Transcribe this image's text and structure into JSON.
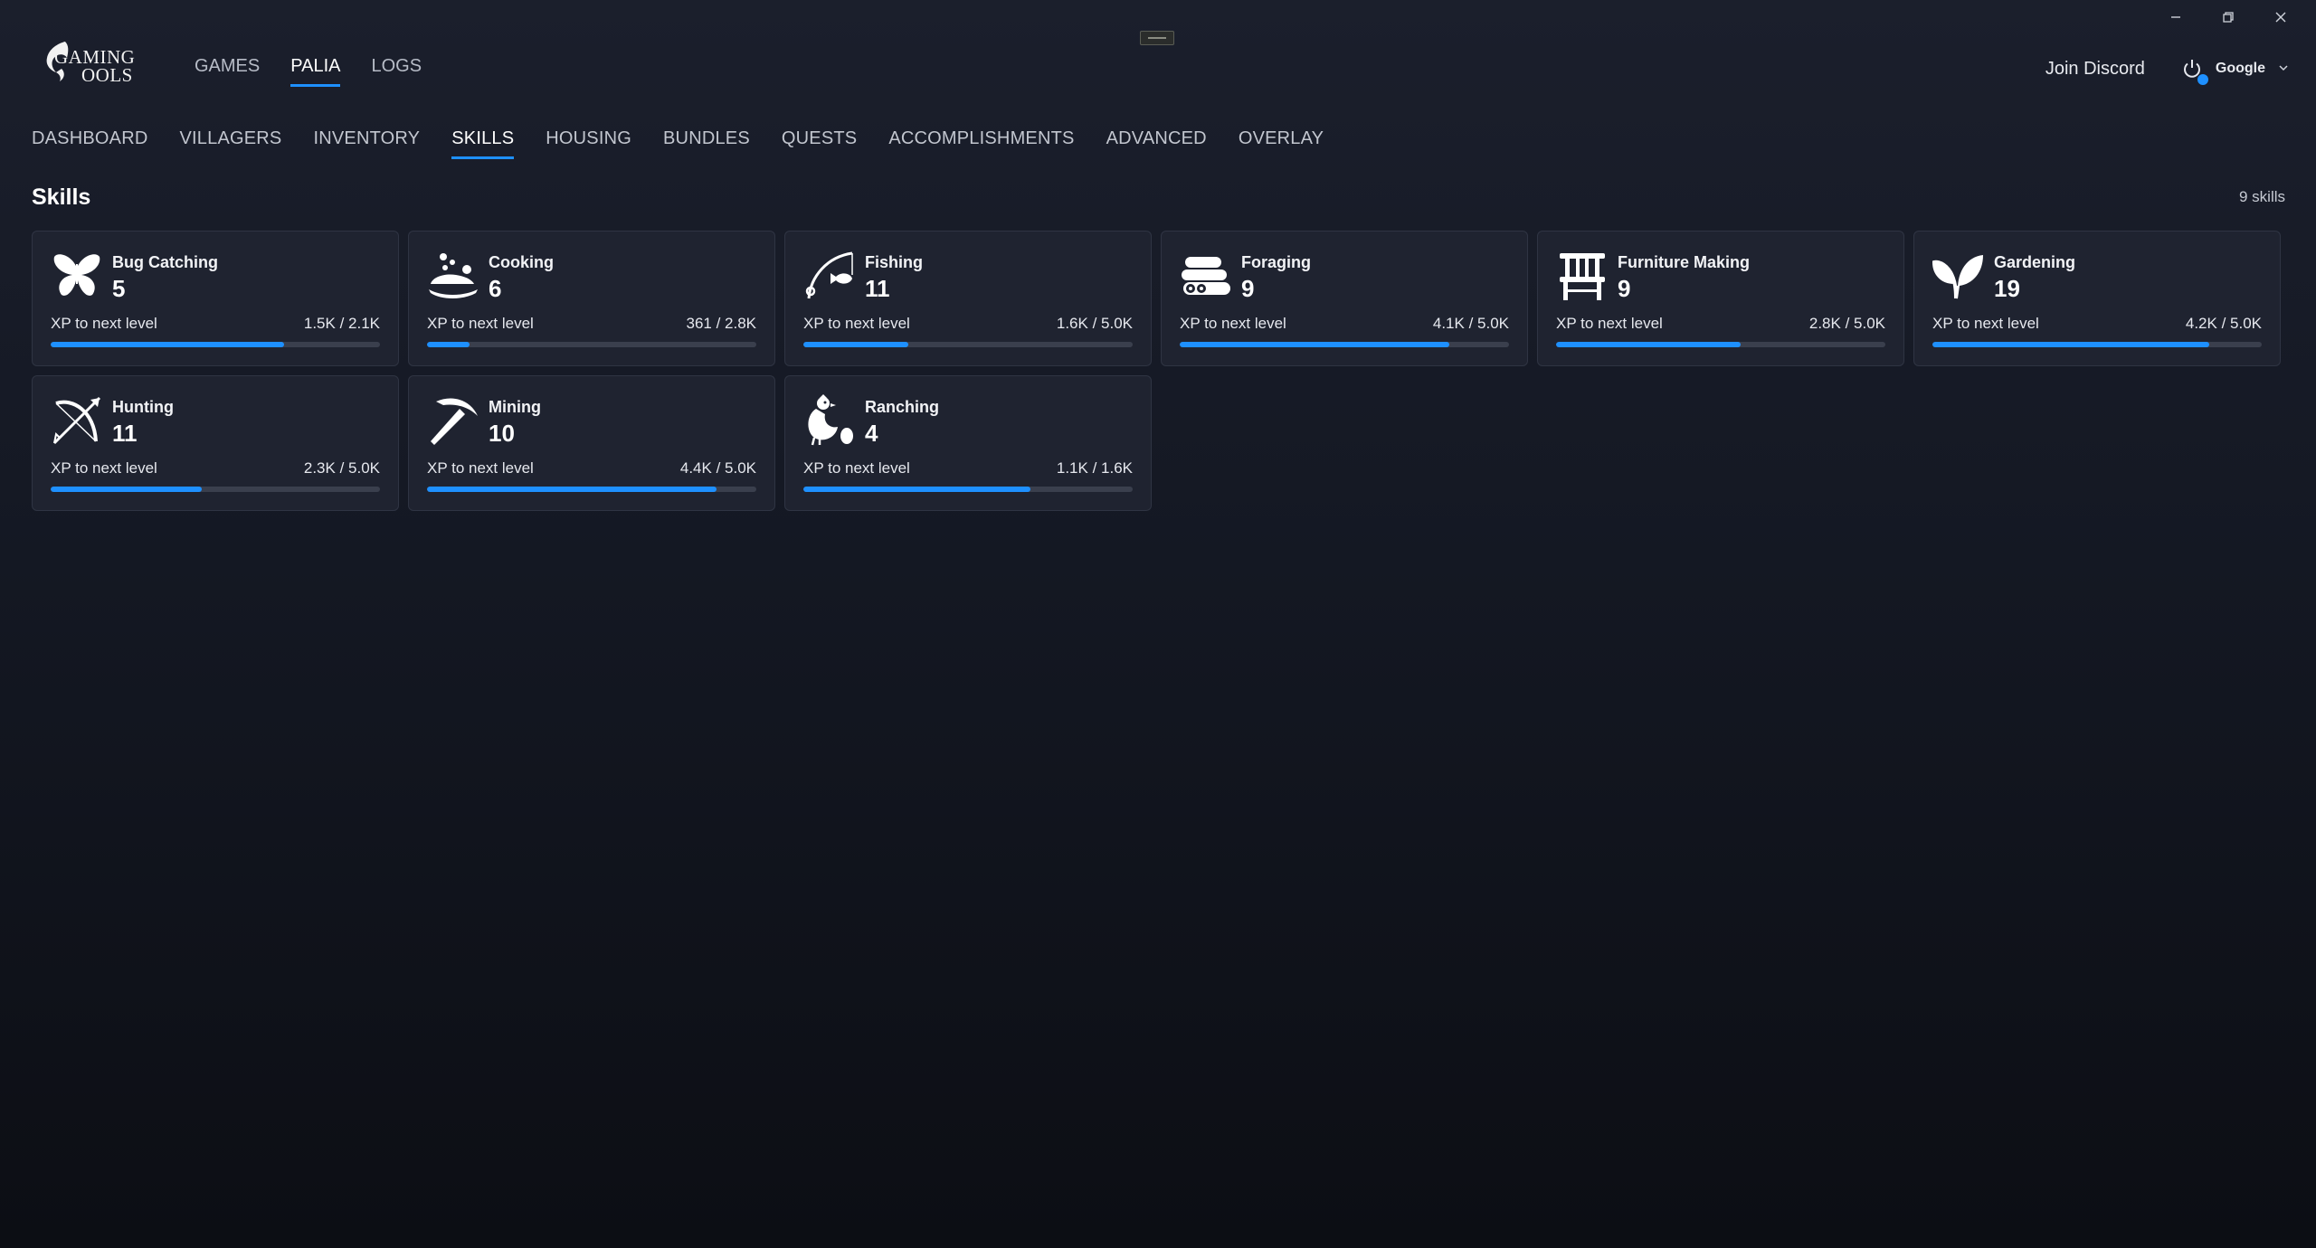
{
  "logo": {
    "line1": "GAMING",
    "line2": "OOLS",
    "icon": "dragon-logo-icon"
  },
  "top_nav": [
    {
      "label": "GAMES",
      "active": false
    },
    {
      "label": "PALIA",
      "active": true
    },
    {
      "label": "LOGS",
      "active": false
    }
  ],
  "header": {
    "discord": "Join Discord",
    "user_name": "Google",
    "status_color": "#1e90ff"
  },
  "sub_nav": [
    {
      "label": "DASHBOARD",
      "active": false
    },
    {
      "label": "VILLAGERS",
      "active": false
    },
    {
      "label": "INVENTORY",
      "active": false
    },
    {
      "label": "SKILLS",
      "active": true
    },
    {
      "label": "HOUSING",
      "active": false
    },
    {
      "label": "BUNDLES",
      "active": false
    },
    {
      "label": "QUESTS",
      "active": false
    },
    {
      "label": "ACCOMPLISHMENTS",
      "active": false
    },
    {
      "label": "ADVANCED",
      "active": false
    },
    {
      "label": "OVERLAY",
      "active": false
    }
  ],
  "section": {
    "title": "Skills",
    "count": "9 skills"
  },
  "skills": [
    {
      "name": "Bug Catching",
      "level": "5",
      "xp_label": "XP to next level",
      "xp_value": "1.5K / 2.1K",
      "progress": 0.71,
      "icon": "butterfly-icon"
    },
    {
      "name": "Cooking",
      "level": "6",
      "xp_label": "XP to next level",
      "xp_value": "361 / 2.8K",
      "progress": 0.13,
      "icon": "cooking-pot-icon"
    },
    {
      "name": "Fishing",
      "level": "11",
      "xp_label": "XP to next level",
      "xp_value": "1.6K / 5.0K",
      "progress": 0.32,
      "icon": "fishing-rod-icon"
    },
    {
      "name": "Foraging",
      "level": "9",
      "xp_label": "XP to next level",
      "xp_value": "4.1K / 5.0K",
      "progress": 0.82,
      "icon": "logs-icon"
    },
    {
      "name": "Furniture Making",
      "level": "9",
      "xp_label": "XP to next level",
      "xp_value": "2.8K / 5.0K",
      "progress": 0.56,
      "icon": "chair-icon"
    },
    {
      "name": "Gardening",
      "level": "19",
      "xp_label": "XP to next level",
      "xp_value": "4.2K / 5.0K",
      "progress": 0.84,
      "icon": "sprout-icon"
    },
    {
      "name": "Hunting",
      "level": "11",
      "xp_label": "XP to next level",
      "xp_value": "2.3K / 5.0K",
      "progress": 0.46,
      "icon": "bow-icon"
    },
    {
      "name": "Mining",
      "level": "10",
      "xp_label": "XP to next level",
      "xp_value": "4.4K / 5.0K",
      "progress": 0.88,
      "icon": "pickaxe-icon"
    },
    {
      "name": "Ranching",
      "level": "4",
      "xp_label": "XP to next level",
      "xp_value": "1.1K / 1.6K",
      "progress": 0.69,
      "icon": "chicken-icon"
    }
  ]
}
